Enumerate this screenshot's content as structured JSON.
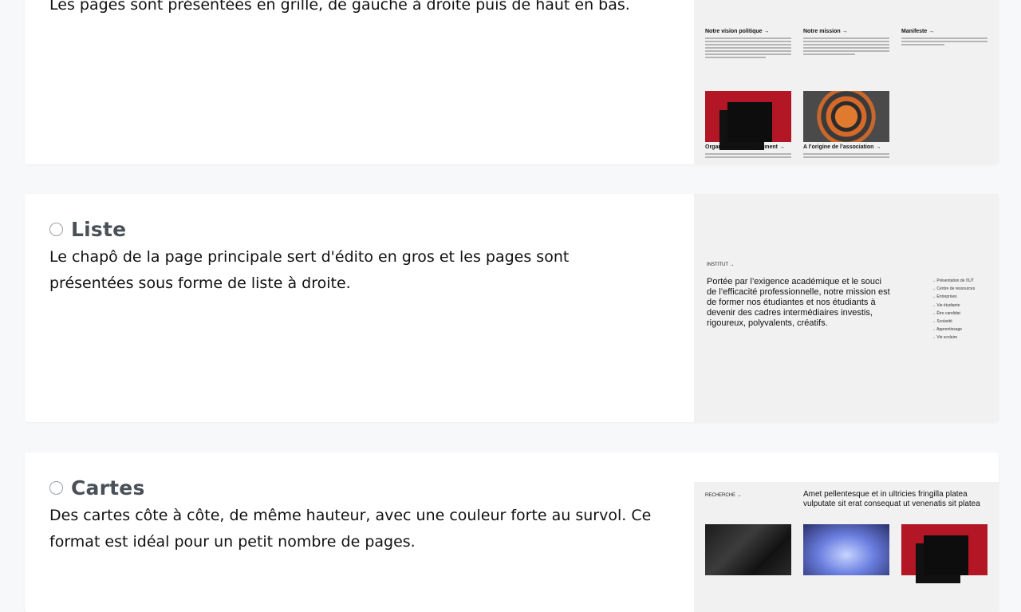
{
  "cards": [
    {
      "description": "Les pages sont présentées en grille, de gauche à droite puis de haut en bas.",
      "preview": {
        "items": [
          {
            "title": "Notre vision politique →"
          },
          {
            "title": "Notre mission →"
          },
          {
            "title": "Manifeste →"
          },
          {
            "title": "Organes et fonctionnement →"
          },
          {
            "title": "A l’origine de l’association →"
          }
        ]
      }
    },
    {
      "title": "Liste",
      "description": "Le chapô de la page principale sert d'édito en gros et les pages sont présentées sous forme de liste à droite.",
      "preview": {
        "label": "INSTITUT →",
        "paragraph": "Portée par l’exigence académique et le souci de l’efficacité professionnelle, notre mission est de former nos étudiantes et nos étudiants à devenir des cadres intermédiaires investis, rigoureux, polyvalents, créatifs.",
        "links": [
          "→ Présentation de l'IUT",
          "→ Centre de ressources",
          "→ Entreprises",
          "→ Vie étudiante",
          "→ Être candidat",
          "→ Scolarité",
          "→ Apprentissage",
          "→ Vie scolaire"
        ]
      }
    },
    {
      "title": "Cartes",
      "description": "Des cartes côte à côte, de même hauteur, avec une couleur forte au survol. Ce format est idéal pour un petit nombre de pages.",
      "preview": {
        "label": "RECHERCHE →",
        "heading": "Amet pellentesque et in ultricies fringilla platea vulputate sit erat consequat ut venenatis sit platea"
      }
    }
  ]
}
